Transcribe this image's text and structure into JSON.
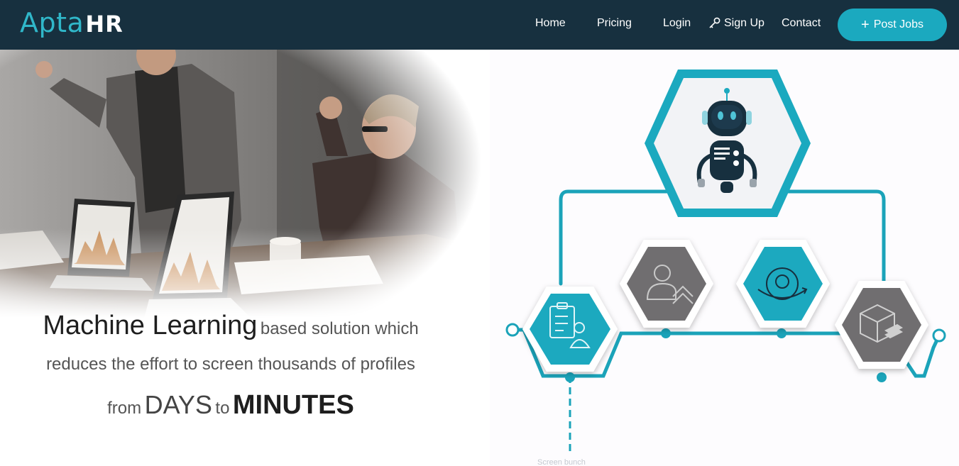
{
  "brand": {
    "logo_part1": "Apta",
    "logo_part2": "HR"
  },
  "nav": {
    "home": "Home",
    "pricing": "Pricing",
    "login": "Login",
    "signup": "Sign Up",
    "contact": "Contact",
    "post_jobs": "Post Jobs"
  },
  "hero": {
    "headline_big": "Machine Learning",
    "headline_small": "based solution which",
    "line2": "reduces the effort to screen thousands of profiles",
    "line3_from": "from",
    "line3_days": "DAYS",
    "line3_to": "to",
    "line3_minutes": "MINUTES"
  },
  "diagram": {
    "caption": "Screen bunch"
  },
  "colors": {
    "navbar": "#17303f",
    "accent": "#1ba9bf",
    "hex_gray": "#6f6e6f",
    "hex_teal": "#1ba9bf"
  },
  "icons": [
    "key-icon",
    "plus-icon",
    "robot-icon",
    "candidate-checklist-icon",
    "user-up-icon",
    "eye-rotate-icon",
    "package-icon"
  ]
}
